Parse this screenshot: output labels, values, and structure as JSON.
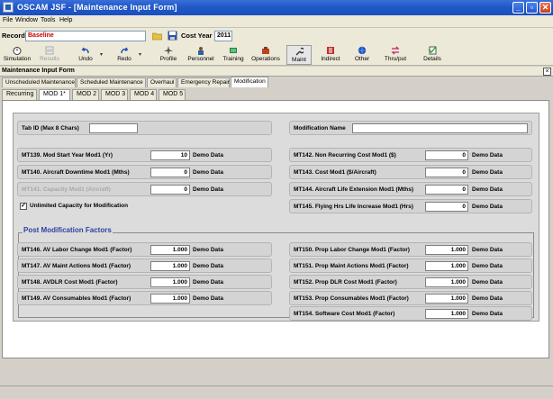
{
  "window": {
    "title": "OSCAM JSF - [Maintenance Input Form]"
  },
  "menu": [
    "File",
    "Window",
    "Tools",
    "Help"
  ],
  "record": {
    "label": "Record",
    "value": "Baseline",
    "cost_year_label": "Cost Year",
    "cost_year_value": "2011"
  },
  "toolbar": [
    {
      "label": "Simulation",
      "icon": "stopwatch-icon"
    },
    {
      "label": "Results",
      "icon": "results-icon"
    },
    {
      "label": "Undo",
      "icon": "undo-icon"
    },
    {
      "label": "Redo",
      "icon": "redo-icon"
    },
    {
      "label": "Profile",
      "icon": "aircraft-icon"
    },
    {
      "label": "Personnel",
      "icon": "personnel-icon"
    },
    {
      "label": "Training",
      "icon": "training-icon"
    },
    {
      "label": "Operations",
      "icon": "operations-icon"
    },
    {
      "label": "Maint",
      "icon": "wrench-icon"
    },
    {
      "label": "Indirect",
      "icon": "indirect-icon"
    },
    {
      "label": "Other",
      "icon": "globe-icon"
    },
    {
      "label": "Thru/put",
      "icon": "throughput-icon"
    },
    {
      "label": "Details",
      "icon": "details-icon"
    }
  ],
  "form": {
    "title": "Maintenance Input Form"
  },
  "tabs_main": [
    "Unscheduled Maintenance",
    "Scheduled Maintenance",
    "Overhaul",
    "Emergency Repair",
    "Modification"
  ],
  "tabs_sub": [
    "Recurring",
    "MOD 1*",
    "MOD 2",
    "MOD 3",
    "MOD 4",
    "MOD 5"
  ],
  "top_fields": {
    "tab_id_label": "Tab ID (Max 8 Chars)",
    "mod_name_label": "Modification Name"
  },
  "left_rows": [
    {
      "label": "MT139. Mod Start Year Mod1 (Yr)",
      "value": "10",
      "tag": "Demo Data"
    },
    {
      "label": "MT140. Aircraft Downtime Mod1 (Mths)",
      "value": "0",
      "tag": "Demo Data"
    },
    {
      "label": "MT141. Capacity Mod1 (Aircraft)",
      "value": "0",
      "tag": "Demo Data"
    }
  ],
  "checkbox": {
    "label": "Unlimited Capacity for Modification",
    "checked": "✓"
  },
  "right_rows": [
    {
      "label": "MT142. Non Recurring Cost Mod1 ($)",
      "value": "0",
      "tag": "Demo Data"
    },
    {
      "label": "MT143. Cost Mod1 ($/Aircraft)",
      "value": "0",
      "tag": "Demo Data"
    },
    {
      "label": "MT144. Aircraft Life Extension Mod1 (Mths)",
      "value": "0",
      "tag": "Demo Data"
    },
    {
      "label": "MT145. Flying Hrs Life Increase Mod1 (Hrs)",
      "value": "0",
      "tag": "Demo Data"
    }
  ],
  "post_mod": {
    "legend": "Post Modification Factors",
    "left": [
      {
        "label": "MT146. AV Labor Change Mod1 (Factor)",
        "value": "1.000",
        "tag": "Demo Data"
      },
      {
        "label": "MT147. AV Maint Actions Mod1 (Factor)",
        "value": "1.000",
        "tag": "Demo Data"
      },
      {
        "label": "MT148. AVDLR Cost Mod1 (Factor)",
        "value": "1.000",
        "tag": "Demo Data"
      },
      {
        "label": "MT149. AV Consumables Mod1 (Factor)",
        "value": "1.000",
        "tag": "Demo Data"
      }
    ],
    "right": [
      {
        "label": "MT150. Prop Labor Change Mod1 (Factor)",
        "value": "1.000",
        "tag": "Demo Data"
      },
      {
        "label": "MT151. Prop Maint Actions Mod1 (Factor)",
        "value": "1.000",
        "tag": "Demo Data"
      },
      {
        "label": "MT152. Prop DLR Cost Mod1 (Factor)",
        "value": "1.000",
        "tag": "Demo Data"
      },
      {
        "label": "MT153. Prop Consumables Mod1 (Factor)",
        "value": "1.000",
        "tag": "Demo Data"
      },
      {
        "label": "MT154. Software Cost Mod1 (Factor)",
        "value": "1.000",
        "tag": "Demo Data"
      }
    ]
  },
  "colors": {
    "title_blue": "#2058c8",
    "record_red": "#cc0000",
    "legend_blue": "#3040a0"
  }
}
